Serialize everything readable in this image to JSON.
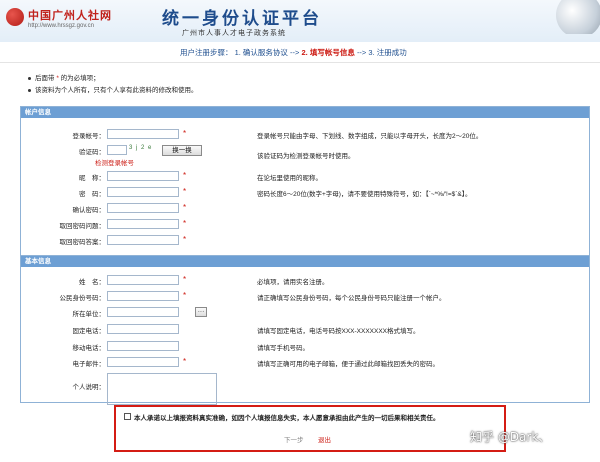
{
  "header": {
    "logo_text": "中国广州人社网",
    "logo_url": "http://www.hrssgz.gov.cn",
    "title": "统一身份认证平台",
    "subtitle": "广州市人事人才电子政务系统"
  },
  "steps": {
    "prefix": "用户注册步骤：",
    "step1": "1. 确认服务协议",
    "arrow": "-->",
    "step2": "2. 填写帐号信息",
    "step3": "3. 注册成功"
  },
  "notes": {
    "line1_a": "后面带",
    "line1_star": "*",
    "line1_b": "的为必填项；",
    "line2": "该资料为个人所有，只有个人享有此资料的修改和使用。"
  },
  "account": {
    "header": "帐户信息",
    "login_label": "登录帐号：",
    "login_hint": "登录帐号只能由字母、下划线、数字组成，只能以字母开头，长度为2～20位。",
    "captcha_label": "验证码：",
    "captcha_image": "3 j 2 e",
    "captcha_button": "换一换",
    "captcha_hint": "该验证码为检测登录帐号时使用。",
    "check_link": "检测登录帐号",
    "nick_label": "昵　称：",
    "nick_hint": "在论坛里使用的昵称。",
    "pwd_label": "密　码：",
    "pwd_hint": "密码长度6～20位(数字+字母)，请不要使用特殊符号，如：【`~*%/'!=$`&】。",
    "confirm_label": "确认密码：",
    "question_label": "取回密码问题：",
    "answer_label": "取回密码答案："
  },
  "basic": {
    "header": "基本信息",
    "name_label": "姓　名：",
    "name_hint": "必填项，请用实名注册。",
    "id_label": "公民身份号码：",
    "id_hint": "请正确填写公民身份号码，每个公民身份号码只能注册一个帐户。",
    "unit_label": "所在单位：",
    "unit_button": "···",
    "phone_label": "固定电话：",
    "phone_hint": "请填写固定电话，电话号码按XXX-XXXXXXX格式填写。",
    "mobile_label": "移动电话：",
    "mobile_hint": "请填写手机号码。",
    "email_label": "电子邮件：",
    "email_hint": "请填写正确可用的电子邮箱，便于通过此邮箱找回丢失的密码。",
    "desc_label": "个人说明："
  },
  "confirm": {
    "text": "本人承诺以上填报资料真实准确，如因个人填报信息失实，本人愿意承担由此产生的一切后果和相关责任。",
    "next": "下一步",
    "exit": "退出"
  },
  "watermark": "知乎 @Dark、",
  "colors": {
    "accent_red": "#cc1a12",
    "panel_header": "#6d9fd4",
    "title_blue": "#1e4c8c"
  }
}
